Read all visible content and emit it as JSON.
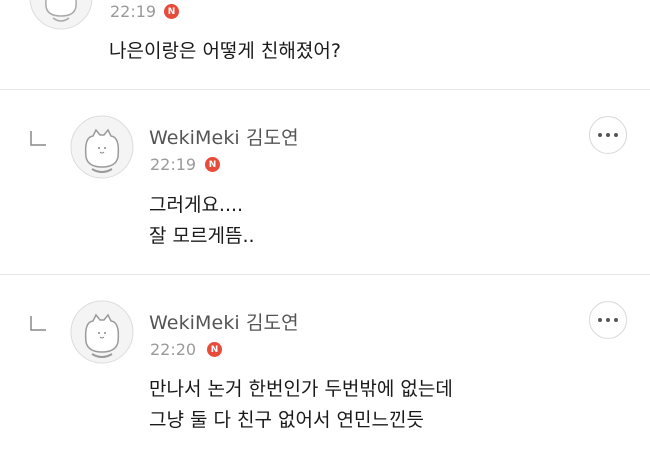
{
  "comments": [
    {
      "time": "22:19",
      "badge": "N",
      "text": "나은이랑은 어떻게 친해졌어?"
    },
    {
      "author": "WekiMeki 김도연",
      "time": "22:19",
      "badge": "N",
      "lines": [
        "그러게요....",
        "잘 모르게뜸.."
      ]
    },
    {
      "author": "WekiMeki 김도연",
      "time": "22:20",
      "badge": "N",
      "lines": [
        "만나서 논거 한번인가 두번밖에 없는데",
        "그냥 둘 다 친구 없어서 연민느낀듯"
      ]
    }
  ]
}
